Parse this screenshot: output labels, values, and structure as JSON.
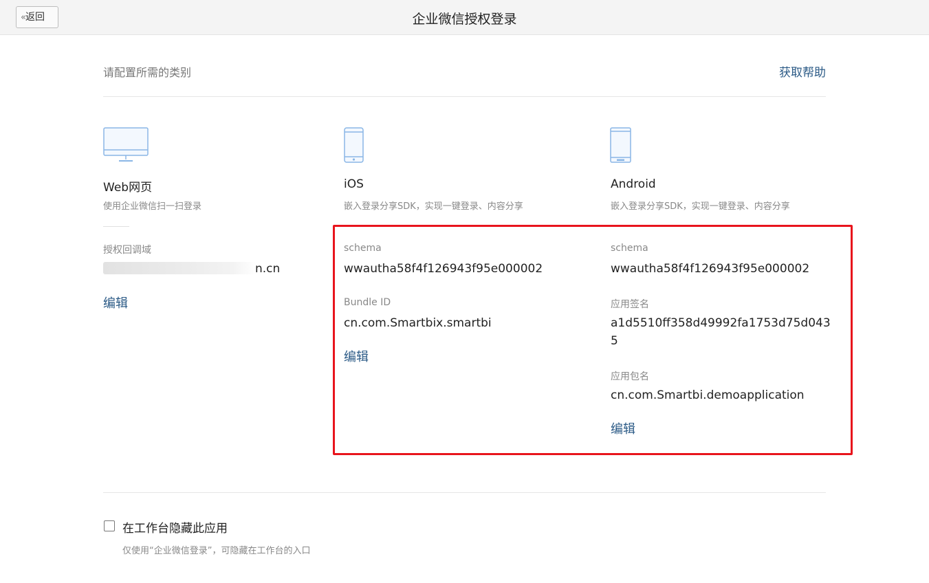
{
  "header": {
    "back_label": "返回",
    "title": "企业微信授权登录"
  },
  "intro": {
    "subtitle": "请配置所需的类别",
    "help_link": "获取帮助"
  },
  "platforms": {
    "web": {
      "icon": "monitor-icon",
      "name": "Web网页",
      "desc": "使用企业微信扫一扫登录",
      "domain_label": "授权回调域",
      "domain_value_visible": "n.cn",
      "edit_label": "编辑"
    },
    "ios": {
      "icon": "iphone-icon",
      "name": "iOS",
      "desc": "嵌入登录分享SDK，实现一键登录、内容分享",
      "schema_label": "schema",
      "schema_value": "wwautha58f4f126943f95e000002",
      "bundle_label": "Bundle ID",
      "bundle_value": "cn.com.Smartbix.smartbi",
      "edit_label": "编辑"
    },
    "android": {
      "icon": "android-phone-icon",
      "name": "Android",
      "desc": "嵌入登录分享SDK，实现一键登录、内容分享",
      "schema_label": "schema",
      "schema_value": "wwautha58f4f126943f95e000002",
      "sign_label": "应用签名",
      "sign_value_line1": "a1d5510ff358d49992fa1753d75d043",
      "sign_value_line2": "5",
      "package_label": "应用包名",
      "package_value": "cn.com.Smartbi.demoapplication",
      "edit_label": "编辑"
    }
  },
  "footer": {
    "checkbox_label": "在工作台隐藏此应用",
    "checkbox_checked": false,
    "checkbox_hint": "仅使用“企业微信登录”，可隐藏在工作台的入口"
  },
  "colors": {
    "link": "#2b5a86",
    "highlight_border": "#e8141c",
    "icon_stroke": "#8ab6e6"
  }
}
